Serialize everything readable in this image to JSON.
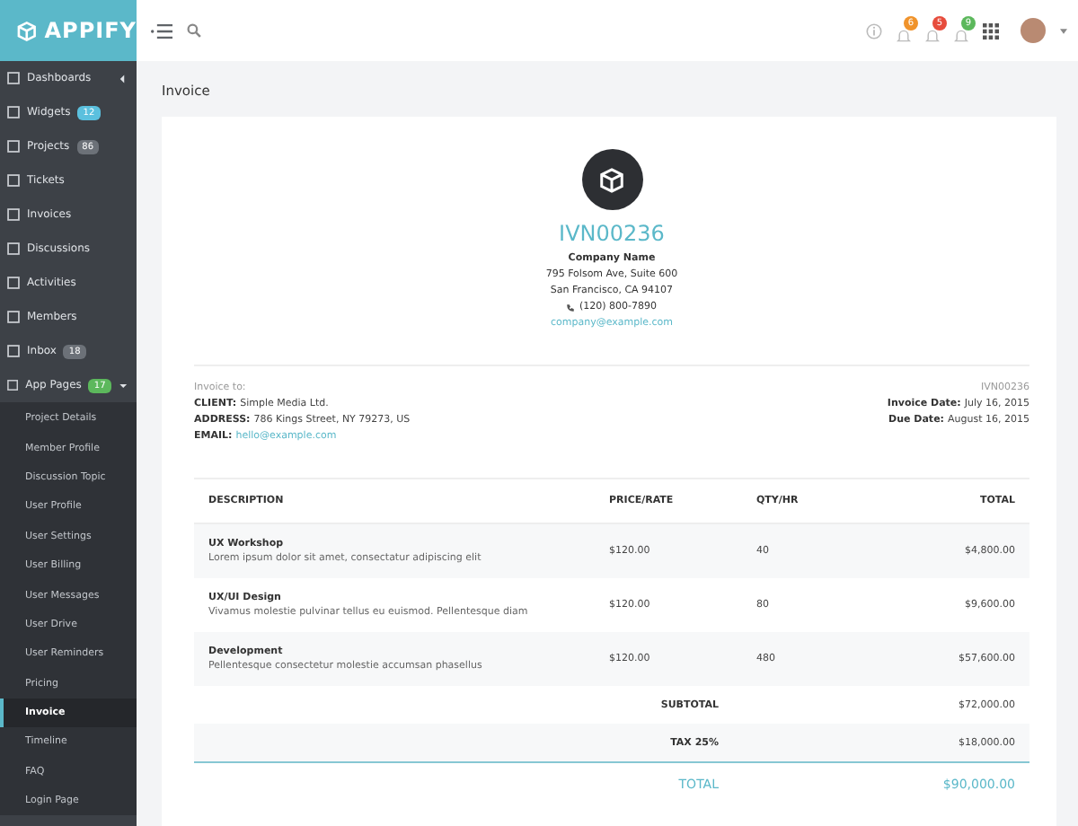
{
  "app": {
    "name": "APPIFY"
  },
  "topbar": {
    "notifications": [
      {
        "count": "6",
        "color": "#f0932b"
      },
      {
        "count": "5",
        "color": "#e74c3c"
      },
      {
        "count": "9",
        "color": "#5cb85c"
      }
    ]
  },
  "sidebar": {
    "items": [
      {
        "label": "Dashboards",
        "expanded": false
      },
      {
        "label": "Widgets",
        "badge": {
          "text": "12",
          "color": "#5bc0de"
        }
      },
      {
        "label": "Projects",
        "badge": {
          "text": "86",
          "color": "#6c7178"
        }
      },
      {
        "label": "Tickets"
      },
      {
        "label": "Invoices"
      },
      {
        "label": "Discussions"
      },
      {
        "label": "Activities"
      },
      {
        "label": "Members"
      },
      {
        "label": "Inbox",
        "badge": {
          "text": "18",
          "color": "#6c7178"
        }
      },
      {
        "label": "App Pages",
        "badge": {
          "text": "17",
          "color": "#5cb85c"
        },
        "expanded": true,
        "children": [
          {
            "label": "Project Details",
            "selected": false
          },
          {
            "label": "Member Profile",
            "selected": false
          },
          {
            "label": "Discussion Topic",
            "selected": false
          },
          {
            "label": "User Profile",
            "selected": false
          },
          {
            "label": "User Settings",
            "selected": false
          },
          {
            "label": "User Billing",
            "selected": false
          },
          {
            "label": "User Messages",
            "selected": false
          },
          {
            "label": "User Drive",
            "selected": false
          },
          {
            "label": "User Reminders",
            "selected": false
          },
          {
            "label": "Pricing",
            "selected": false
          },
          {
            "label": "Invoice",
            "selected": true
          },
          {
            "label": "Timeline",
            "selected": false
          },
          {
            "label": "FAQ",
            "selected": false
          },
          {
            "label": "Login Page",
            "selected": false
          }
        ]
      }
    ]
  },
  "page": {
    "title": "Invoice"
  },
  "invoice": {
    "number": "IVN00236",
    "company": {
      "name": "Company Name",
      "address": [
        "795 Folsom Ave, Suite 600",
        "San Francisco, CA 94107"
      ],
      "phone": "(120) 800-7890",
      "email": "company@example.com"
    },
    "bill_to": {
      "heading": "Invoice to:",
      "fields": [
        {
          "label": "CLIENT:",
          "value": "Simple Media Ltd.",
          "kind": "text"
        },
        {
          "label": "ADDRESS:",
          "value": "786 Kings Street, NY 79273, US",
          "kind": "text"
        },
        {
          "label": "EMAIL:",
          "value": "hello@example.com",
          "kind": "link"
        }
      ]
    },
    "meta": {
      "number": "IVN00236",
      "fields": [
        {
          "label": "Invoice Date:",
          "value": "July 16, 2015"
        },
        {
          "label": "Due Date:",
          "value": "August 16, 2015"
        }
      ]
    },
    "table": {
      "columns": [
        "DESCRIPTION",
        "PRICE/RATE",
        "QTY/HR",
        "TOTAL"
      ],
      "rows": [
        {
          "title": "UX Workshop",
          "description": "Lorem ipsum dolor sit amet, consectatur adipiscing elit",
          "price": "$120.00",
          "qty": "40",
          "total": "$4,800.00"
        },
        {
          "title": "UX/UI Design",
          "description": "Vivamus molestie pulvinar tellus eu euismod. Pellentesque diam",
          "price": "$120.00",
          "qty": "80",
          "total": "$9,600.00"
        },
        {
          "title": "Development",
          "description": "Pellentesque consectetur molestie accumsan phasellus",
          "price": "$120.00",
          "qty": "480",
          "total": "$57,600.00"
        }
      ]
    },
    "summary": [
      {
        "label": "SUBTOTAL",
        "value": "$72,000.00",
        "kind": "subtotal"
      },
      {
        "label": "TAX 25%",
        "value": "$18,000.00",
        "kind": "tax"
      },
      {
        "label": "TOTAL",
        "value": "$90,000.00",
        "kind": "total"
      }
    ]
  }
}
